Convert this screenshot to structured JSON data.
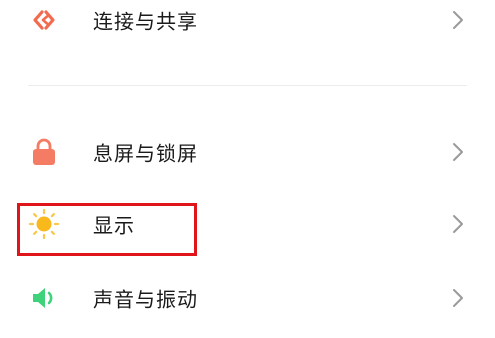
{
  "settings": {
    "items": [
      {
        "label": "连接与共享",
        "icon": "connection-share-icon",
        "icon_color": "#f26b4e"
      },
      {
        "label": "息屏与锁屏",
        "icon": "lock-icon",
        "icon_color": "#f47c65"
      },
      {
        "label": "显示",
        "icon": "sun-icon",
        "icon_color": "#f9b81b"
      },
      {
        "label": "声音与振动",
        "icon": "speaker-icon",
        "icon_color": "#3ed37b"
      }
    ]
  },
  "highlight": {
    "color": "#e0151a",
    "target": "显示"
  }
}
